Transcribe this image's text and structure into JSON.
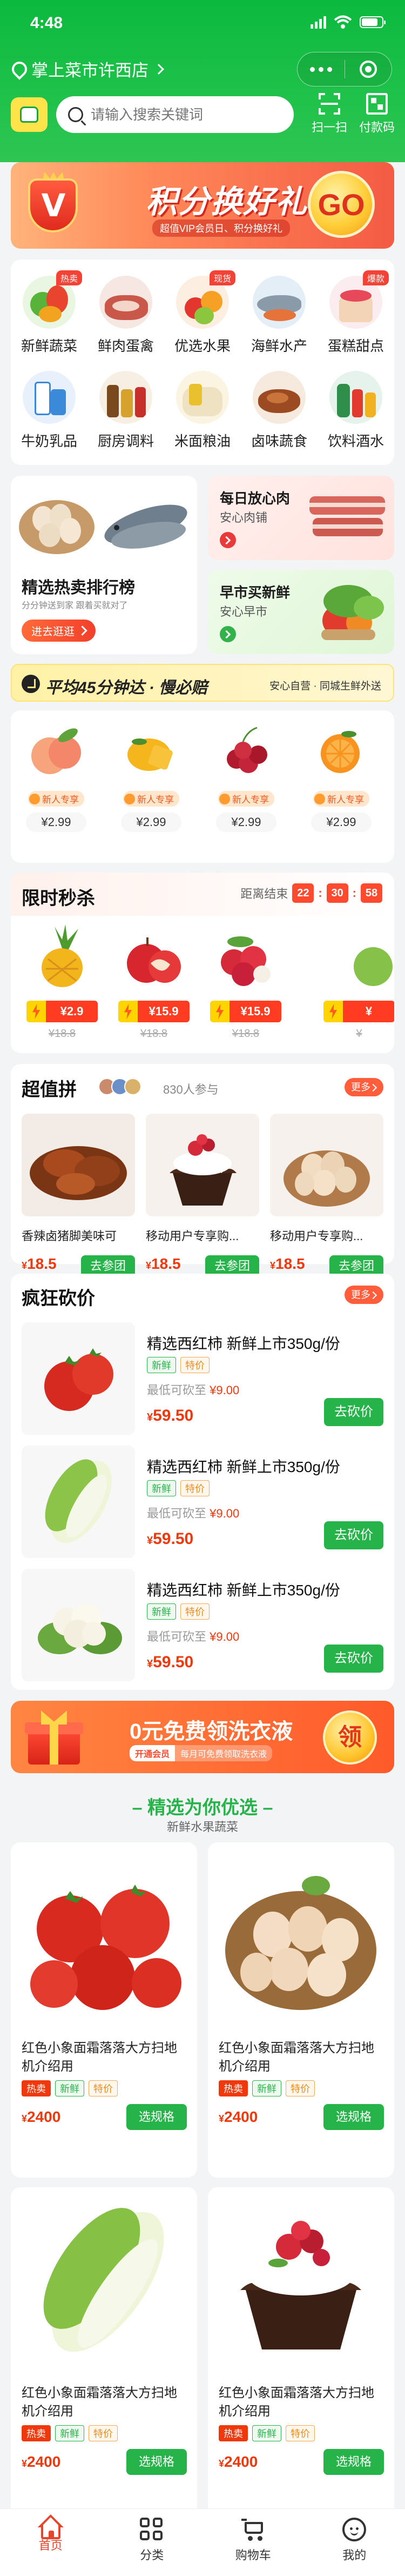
{
  "status": {
    "time": "4:48"
  },
  "header": {
    "store_name": "掌上菜市许西店",
    "search_placeholder": "请输入搜索关键词",
    "scan_label": "扫一扫",
    "pay_label": "付款码"
  },
  "banner": {
    "title": "积分换好礼",
    "subtitle": "超值VIP会员日、积分换好礼",
    "go_label": "GO"
  },
  "categories": [
    {
      "label": "新鲜蔬菜",
      "tag": "热卖"
    },
    {
      "label": "鲜肉蛋禽",
      "tag": ""
    },
    {
      "label": "优选水果",
      "tag": "现货"
    },
    {
      "label": "海鲜水产",
      "tag": ""
    },
    {
      "label": "蛋糕甜点",
      "tag": "爆款"
    },
    {
      "label": "牛奶乳品",
      "tag": ""
    },
    {
      "label": "厨房调料",
      "tag": ""
    },
    {
      "label": "米面粮油",
      "tag": ""
    },
    {
      "label": "卤味蔬食",
      "tag": ""
    },
    {
      "label": "饮料酒水",
      "tag": ""
    }
  ],
  "promos": {
    "hot_rank": {
      "title": "精选热卖排行榜",
      "tiny": "分分钟送到家 跟着买就对了",
      "button": "进去逛逛"
    },
    "meat": {
      "title": "每日放心肉",
      "sub": "安心肉铺"
    },
    "breakfast": {
      "title": "早市买新鲜",
      "sub": "安心早市"
    }
  },
  "delivery": {
    "title": "平均45分钟达 · 慢必赔",
    "right": "安心自营 · 同城生鲜外送"
  },
  "fruits": [
    {
      "tag": "新人专享",
      "price": "¥2.99"
    },
    {
      "tag": "新人专享",
      "price": "¥2.99"
    },
    {
      "tag": "新人专享",
      "price": "¥2.99"
    },
    {
      "tag": "新人专享",
      "price": "¥2.99"
    }
  ],
  "flash": {
    "title": "限时秒杀",
    "ends_label": "距离结束",
    "hh": "22",
    "mm": "30",
    "ss": "58",
    "items": [
      {
        "price": "¥2.9",
        "orig": "¥18.8"
      },
      {
        "price": "¥15.9",
        "orig": "¥18.8"
      },
      {
        "price": "¥15.9",
        "orig": "¥18.8"
      },
      {
        "price": "¥",
        "orig": "¥"
      }
    ]
  },
  "group": {
    "title": "超值拼",
    "joined": "830人参与",
    "more": "更多",
    "items": [
      {
        "name": "香辣卤猪脚美味可",
        "price": "18.5",
        "button": "去参团"
      },
      {
        "name": "移动用户专享购...",
        "price": "18.5",
        "button": "去参团"
      },
      {
        "name": "移动用户专享购...",
        "price": "18.5",
        "button": "去参团"
      }
    ]
  },
  "bargain": {
    "title": "疯狂砍价",
    "more": "更多",
    "items": [
      {
        "name": "精选西红柿 新鲜上市350g/份",
        "chip1": "新鲜",
        "chip2": "特价",
        "low_label": "最低可砍至",
        "low": "¥9.00",
        "price": "59.50",
        "button": "去砍价"
      },
      {
        "name": "精选西红柿 新鲜上市350g/份",
        "chip1": "新鲜",
        "chip2": "特价",
        "low_label": "最低可砍至",
        "low": "¥9.00",
        "price": "59.50",
        "button": "去砍价"
      },
      {
        "name": "精选西红柿 新鲜上市350g/份",
        "chip1": "新鲜",
        "chip2": "特价",
        "low_label": "最低可砍至",
        "low": "¥9.00",
        "price": "59.50",
        "button": "去砍价"
      }
    ]
  },
  "wash": {
    "title": "0元免费领洗衣液",
    "tag_a": "开通会员",
    "tag_b": "每月可免费领取洗衣液",
    "button": "领"
  },
  "featured": {
    "title": "精选为你优选",
    "subtitle": "新鲜水果蔬菜",
    "items": [
      {
        "name": "红色小象面霜落落大方扫地机介绍用",
        "chip1": "热卖",
        "chip2": "新鲜",
        "chip3": "特价",
        "price": "2400",
        "button": "选规格"
      },
      {
        "name": "红色小象面霜落落大方扫地机介绍用",
        "chip1": "热卖",
        "chip2": "新鲜",
        "chip3": "特价",
        "price": "2400",
        "button": "选规格"
      },
      {
        "name": "红色小象面霜落落大方扫地机介绍用",
        "chip1": "热卖",
        "chip2": "新鲜",
        "chip3": "特价",
        "price": "2400",
        "button": "选规格"
      },
      {
        "name": "红色小象面霜落落大方扫地机介绍用",
        "chip1": "热卖",
        "chip2": "新鲜",
        "chip3": "特价",
        "price": "2400",
        "button": "选规格"
      }
    ]
  },
  "tabbar": [
    {
      "label": "首页",
      "icon": "home-icon"
    },
    {
      "label": "分类",
      "icon": "grid-icon"
    },
    {
      "label": "购物车",
      "icon": "cart-icon"
    },
    {
      "label": "我的",
      "icon": "profile-icon"
    }
  ],
  "colors": {
    "brand": "#1fc24a",
    "accent": "#f0380d",
    "button_green": "#26b44a"
  }
}
